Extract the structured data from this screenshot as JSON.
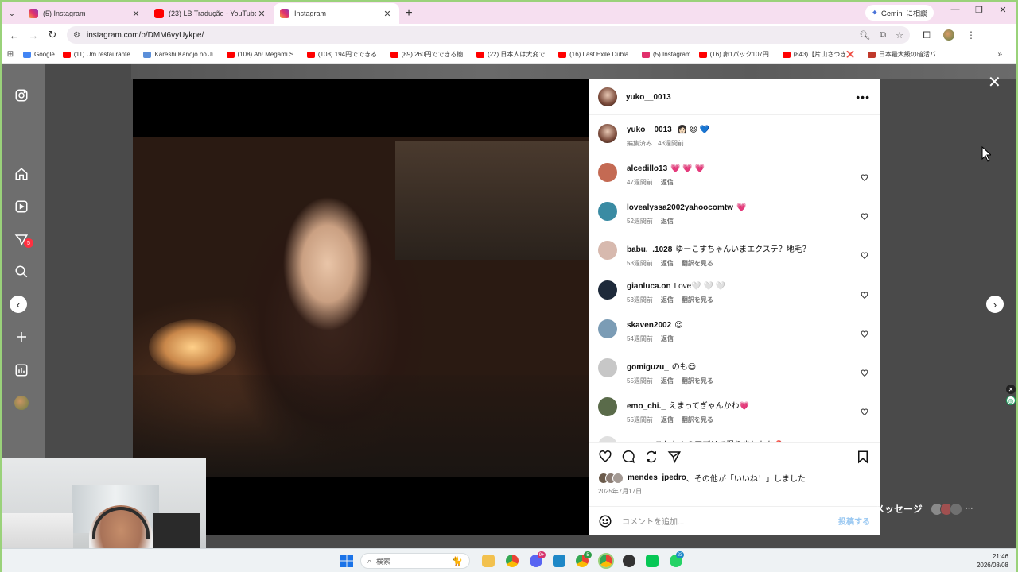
{
  "browser": {
    "tabs": [
      {
        "label": "(5) Instagram",
        "active": false,
        "color": "#e1306c"
      },
      {
        "label": "(23) LB Tradução - YouTube",
        "active": false,
        "color": "#ff0000"
      },
      {
        "label": "Instagram",
        "active": true,
        "color": "#e1306c"
      }
    ],
    "gemini_label": "Gemini に相談",
    "url": "instagram.com/p/DMM6vyUykpe/",
    "bookmarks": [
      {
        "label": "Google",
        "color": "#4285f4"
      },
      {
        "label": "(11) Um restaurante...",
        "color": "#ff0000"
      },
      {
        "label": "Kareshi Kanojo no Ji...",
        "color": "#5b8fd9"
      },
      {
        "label": "(108) Ah! Megami S...",
        "color": "#ff0000"
      },
      {
        "label": "(108) 194円でできる...",
        "color": "#ff0000"
      },
      {
        "label": "(89) 260円でできる簡...",
        "color": "#ff0000"
      },
      {
        "label": "(22) 日本人は大変で...",
        "color": "#ff0000"
      },
      {
        "label": "(16) Last Exile Dubla...",
        "color": "#ff0000"
      },
      {
        "label": "(5) Instagram",
        "color": "#e1306c"
      },
      {
        "label": "(16) 卵1パック107円...",
        "color": "#ff0000"
      },
      {
        "label": "(843)【片山さつき❌...",
        "color": "#ff0000"
      },
      {
        "label": "日本最大級の暗活バ...",
        "color": "#c0392b"
      }
    ]
  },
  "sidebar": {
    "notifications_badge": "5"
  },
  "post": {
    "username": "yuko__0013",
    "caption_emojis": "👩🏻 😆 💙",
    "caption_meta": "編集済み · 43週間前",
    "comments": [
      {
        "user": "alcedillo13",
        "text": "💗 💗 💗",
        "time": "47週間前",
        "reply": "返信",
        "translate": "",
        "avatar": "#c46a53"
      },
      {
        "user": "lovealyssa2002yahoocomtw",
        "text": "💗",
        "time": "52週間前",
        "reply": "返信",
        "translate": "",
        "avatar": "#3a8ba3"
      },
      {
        "user": "babu._.1028",
        "text": "ゆーこすちゃんいまエクステ？地毛？",
        "time": "53週間前",
        "reply": "返信",
        "translate": "翻訳を見る",
        "avatar": "#d7b9ae"
      },
      {
        "user": "gianluca.on",
        "text": "Love🤍 🤍 🤍",
        "time": "53週間前",
        "reply": "返信",
        "translate": "翻訳を見る",
        "avatar": "#1e2a3a"
      },
      {
        "user": "skaven2002",
        "text": "😍",
        "time": "54週間前",
        "reply": "返信",
        "translate": "",
        "avatar": "#7b9cb5"
      },
      {
        "user": "gomiguzu_",
        "text": "のも😍",
        "time": "55週間前",
        "reply": "返信",
        "translate": "翻訳を見る",
        "avatar": "#c7c7c7"
      },
      {
        "user": "emo_chi._",
        "text": "えまってぎゃんかわ💗",
        "time": "55週間前",
        "reply": "返信",
        "translate": "翻訳を見る",
        "avatar": "#5a6b4a"
      },
      {
        "user": "a.t.aae",
        "text": "これなんのアプリで撮りましたか❓",
        "time": "",
        "reply": "",
        "translate": "",
        "avatar": "#e0e0e0"
      }
    ],
    "likes_user": "mendes_jpedro",
    "likes_text": "、その他が「いいね！」しました",
    "likes_others": "その他",
    "date": "2025年7月17日",
    "comment_placeholder": "コメントを追加...",
    "post_button": "投稿する"
  },
  "messages_label": "メッセージ",
  "taskbar": {
    "search_placeholder": "検索",
    "badge_1": "9+",
    "badge_2": "5",
    "badge_3": "23",
    "time": "21:46",
    "date": "2026/08/08"
  }
}
